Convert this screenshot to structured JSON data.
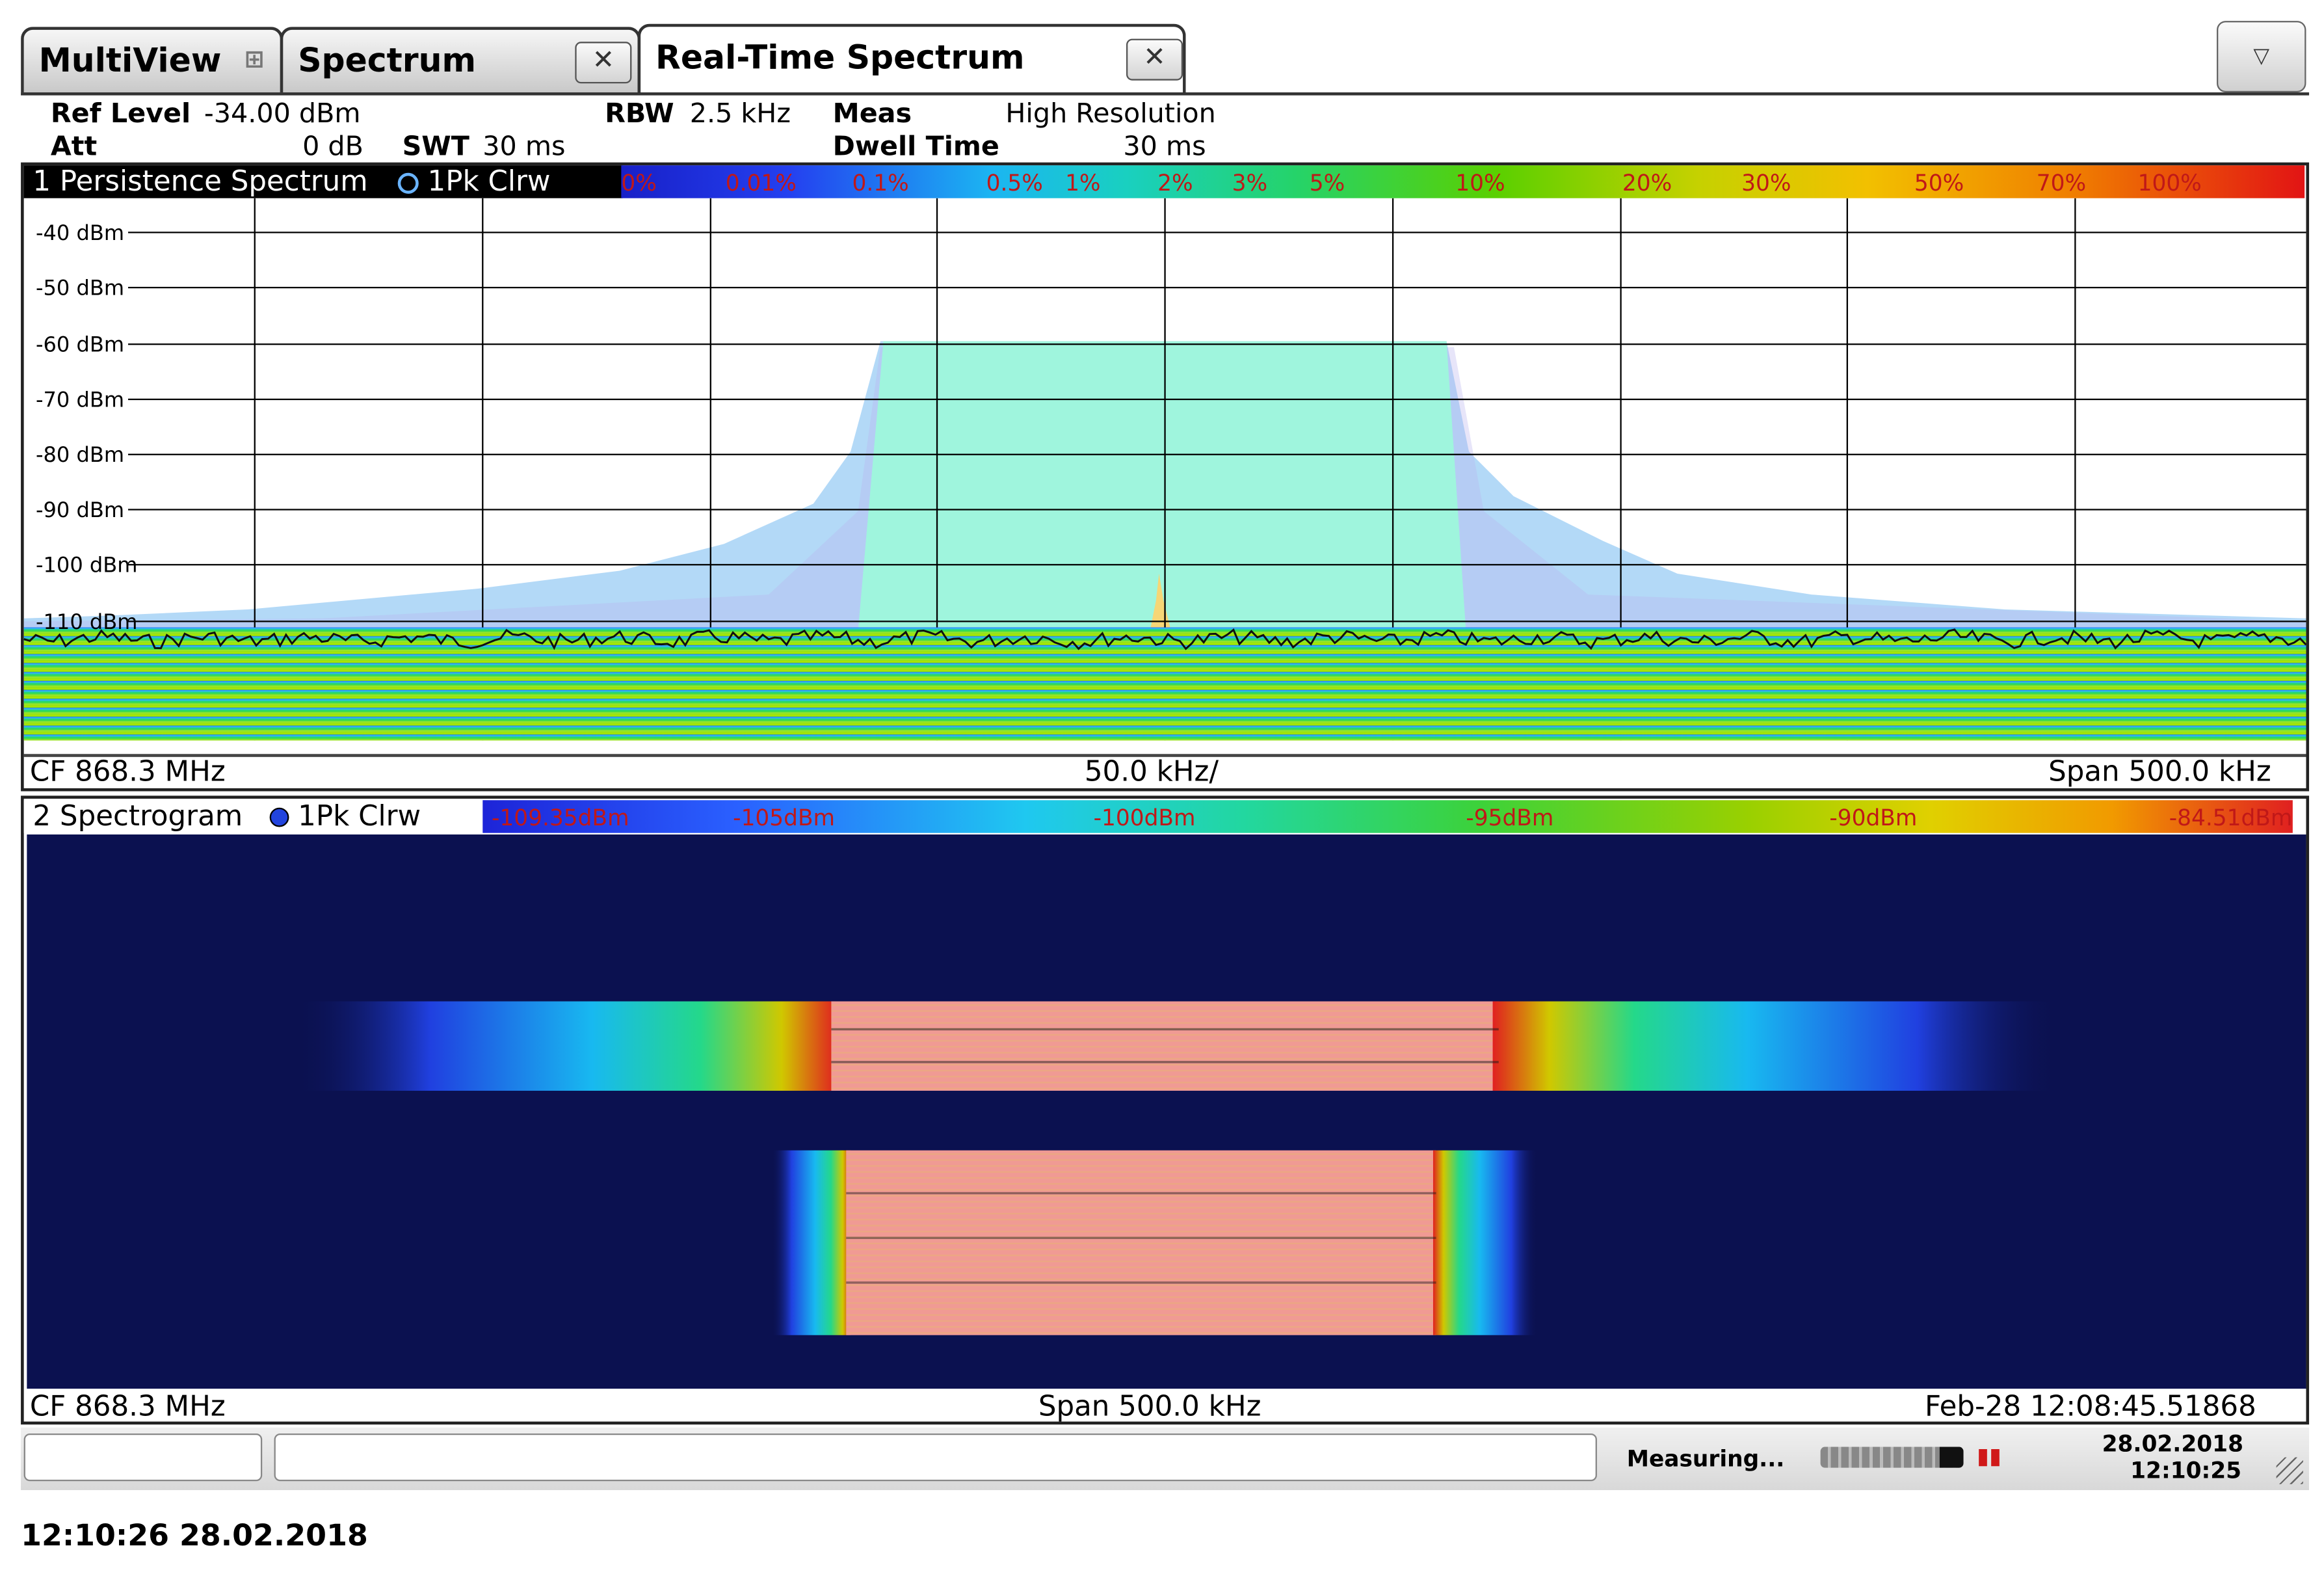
{
  "tabs": [
    {
      "label": "MultiView",
      "active": false
    },
    {
      "label": "Spectrum",
      "active": false
    },
    {
      "label": "Real-Time Spectrum",
      "active": true
    }
  ],
  "icons": {
    "close": "close-icon",
    "grid": "multiview-grid-icon",
    "dropdown": "triangle-down-icon"
  },
  "settings": {
    "ref_level_label": "Ref Level",
    "ref_level_value": "-34.00 dBm",
    "att_label": "Att",
    "att_value": "0 dB",
    "swt_label": "SWT",
    "swt_value": "30 ms",
    "rbw_label": "RBW",
    "rbw_value": "2.5 kHz",
    "meas_label": "Meas",
    "meas_value": "High Resolution",
    "dwell_label": "Dwell Time",
    "dwell_value": "30 ms"
  },
  "persistence": {
    "title": "1 Persistence Spectrum",
    "trace_label": "1Pk Clrw",
    "colorbar_labels": [
      "0%",
      "0.01%",
      "0.1%",
      "0.5%",
      "1%",
      "2%",
      "3%",
      "5%",
      "10%",
      "20%",
      "30%",
      "50%",
      "70%",
      "100%"
    ],
    "y_labels": [
      "-40 dBm",
      "-50 dBm",
      "-60 dBm",
      "-70 dBm",
      "-80 dBm",
      "-90 dBm",
      "-100 dBm",
      "-110 dBm"
    ],
    "footer_left": "CF 868.3 MHz",
    "footer_center": "50.0 kHz/",
    "footer_right": "Span 500.0 kHz"
  },
  "spectrogram": {
    "title": "2 Spectrogram",
    "trace_label": "1Pk Clrw",
    "colorbar_labels": [
      "-109.35dBm",
      "-105dBm",
      "-100dBm",
      "-95dBm",
      "-90dBm",
      "-84.51dBm"
    ],
    "footer_left": "CF 868.3 MHz",
    "footer_center": "Span 500.0 kHz",
    "footer_right": "Feb-28 12:08:45.51868"
  },
  "status": {
    "message": "Measuring...",
    "date": "28.02.2018",
    "time": "12:10:25"
  },
  "capture_timestamp": "12:10:26  28.02.2018",
  "colors": {
    "spectrogram_bg": "#0b1150",
    "signal_fill": "#9ff5dd",
    "burst": "#f09a94"
  }
}
